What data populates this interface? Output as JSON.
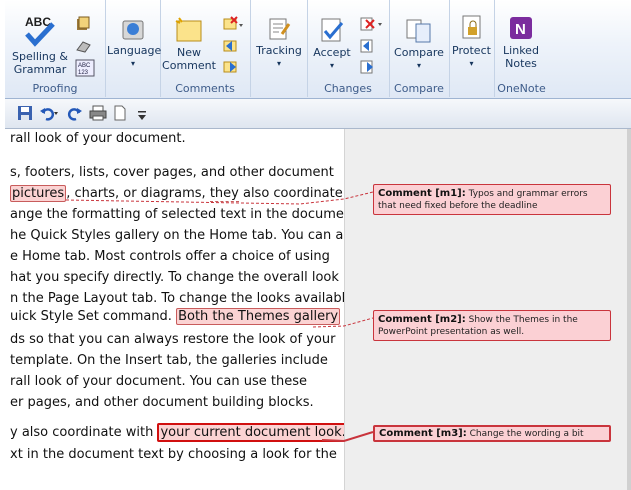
{
  "ribbon": {
    "groups": [
      {
        "label": "Proofing",
        "buttons": [
          "Spelling &",
          "Grammar"
        ]
      },
      {
        "label": "",
        "buttons": [
          "Language"
        ]
      },
      {
        "label": "Comments",
        "buttons": [
          "New",
          "Comment"
        ]
      },
      {
        "label": "",
        "buttons": [
          "Tracking"
        ]
      },
      {
        "label": "Changes",
        "buttons": [
          "Accept"
        ]
      },
      {
        "label": "Compare",
        "buttons": [
          "Compare"
        ]
      },
      {
        "label": "",
        "buttons": [
          "Protect"
        ]
      },
      {
        "label": "OneNote",
        "buttons": [
          "Linked",
          "Notes"
        ]
      }
    ],
    "spelling_icon_text": "ABC",
    "abc123_icon_text": "ABC 123",
    "onenote_icon_text": "N"
  },
  "document": {
    "lines": [
      "rall look of your document.",
      "s, footers, lists, cover pages, and other document",
      "pictures",
      ", charts, or diagrams, ",
      "they",
      " also coordinate",
      "ange the formatting of selected text in the document",
      "he Quick Styles gallery on the Home tab. You can also",
      "e Home tab. Most controls offer a choice of using",
      "hat you specify directly. To change the overall look",
      "n the Page Layout tab. To change the looks available",
      "uick Style Set command. ",
      "Both the Themes gallery",
      "ds so that you can always restore the look of your",
      "template. On the Insert tab, the galleries include",
      "rall look of your document. You can use these",
      "er pages, and other document building blocks.",
      "y also coordinate with ",
      "your current document look.",
      "xt in the document text by choosing a look for the"
    ]
  },
  "comments": [
    {
      "label": "Comment [m1]:",
      "text": "Typos and grammar errors that need fixed before the deadline"
    },
    {
      "label": "Comment [m2]:",
      "text": "Show the Themes in the PowerPoint presentation as well."
    },
    {
      "label": "Comment [m3]:",
      "text": "Change the wording a bit"
    }
  ],
  "colors": {
    "comment_fill": "#fbd0d4",
    "comment_border": "#c9343c",
    "ribbon_text": "#16355d",
    "group_label": "#3e5c8a"
  }
}
